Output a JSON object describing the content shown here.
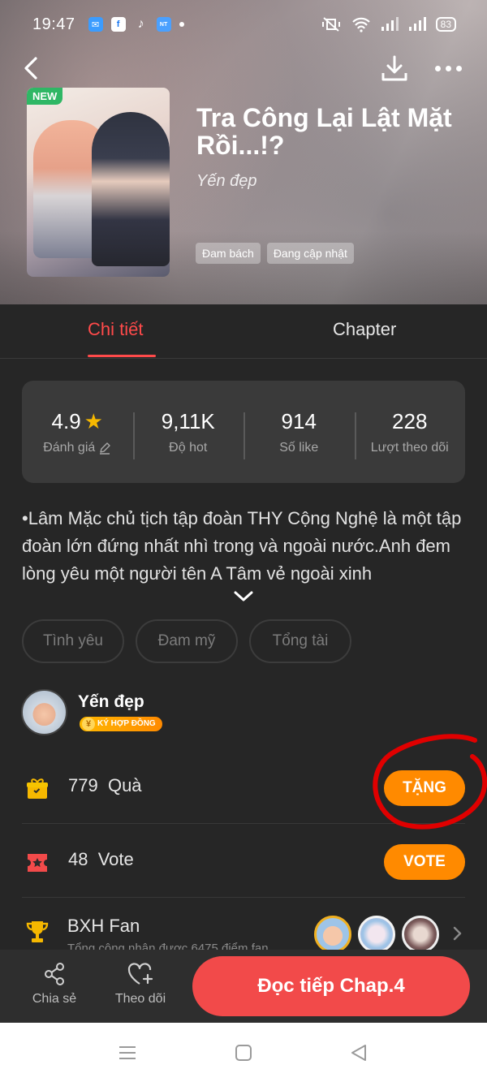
{
  "status_bar": {
    "time": "19:47",
    "battery": "83",
    "apps": [
      "messenger-icon",
      "facebook-icon",
      "tiktok-icon",
      "noveltoon-icon"
    ]
  },
  "header": {
    "badge": "NEW",
    "title": "Tra Công Lại Lật Mặt Rồi...!?",
    "author": "Yến đẹp",
    "tags": [
      "Đam bách",
      "Đang cập nhật"
    ]
  },
  "tabs": [
    {
      "label": "Chi tiết",
      "active": true
    },
    {
      "label": "Chapter",
      "active": false
    }
  ],
  "stats": [
    {
      "value": "4.9",
      "label": "Đánh giá"
    },
    {
      "value": "9,11K",
      "label": "Độ hot"
    },
    {
      "value": "914",
      "label": "Số like"
    },
    {
      "value": "228",
      "label": "Lượt theo dõi"
    }
  ],
  "description": "•Lâm Mặc chủ tịch tập đoàn THY Cộng Nghệ là một tập đoàn lớn đứng nhất nhì trong và ngoài nước.Anh đem lòng yêu một người tên  A Tâm vẻ ngoài xinh",
  "genres": [
    "Tình yêu",
    "Đam mỹ",
    "Tổng tài"
  ],
  "author_section": {
    "name": "Yến đẹp",
    "badge": "KÝ HỢP ĐỒNG"
  },
  "gifts": {
    "count": "779",
    "label": "Quà",
    "button": "TẶNG"
  },
  "votes": {
    "count": "48",
    "label": "Vote",
    "button": "VOTE"
  },
  "fan_ranking": {
    "title": "BXH Fan",
    "subtitle": "Tổng cộng nhận được 6475 điểm fan"
  },
  "action_bar": {
    "share": "Chia sẻ",
    "follow": "Theo dõi",
    "read": "Đọc tiếp Chap.4"
  },
  "colors": {
    "accent_red": "#f24a4a",
    "accent_orange": "#ff8a00",
    "background": "#262626",
    "annotation": "#e00000"
  }
}
